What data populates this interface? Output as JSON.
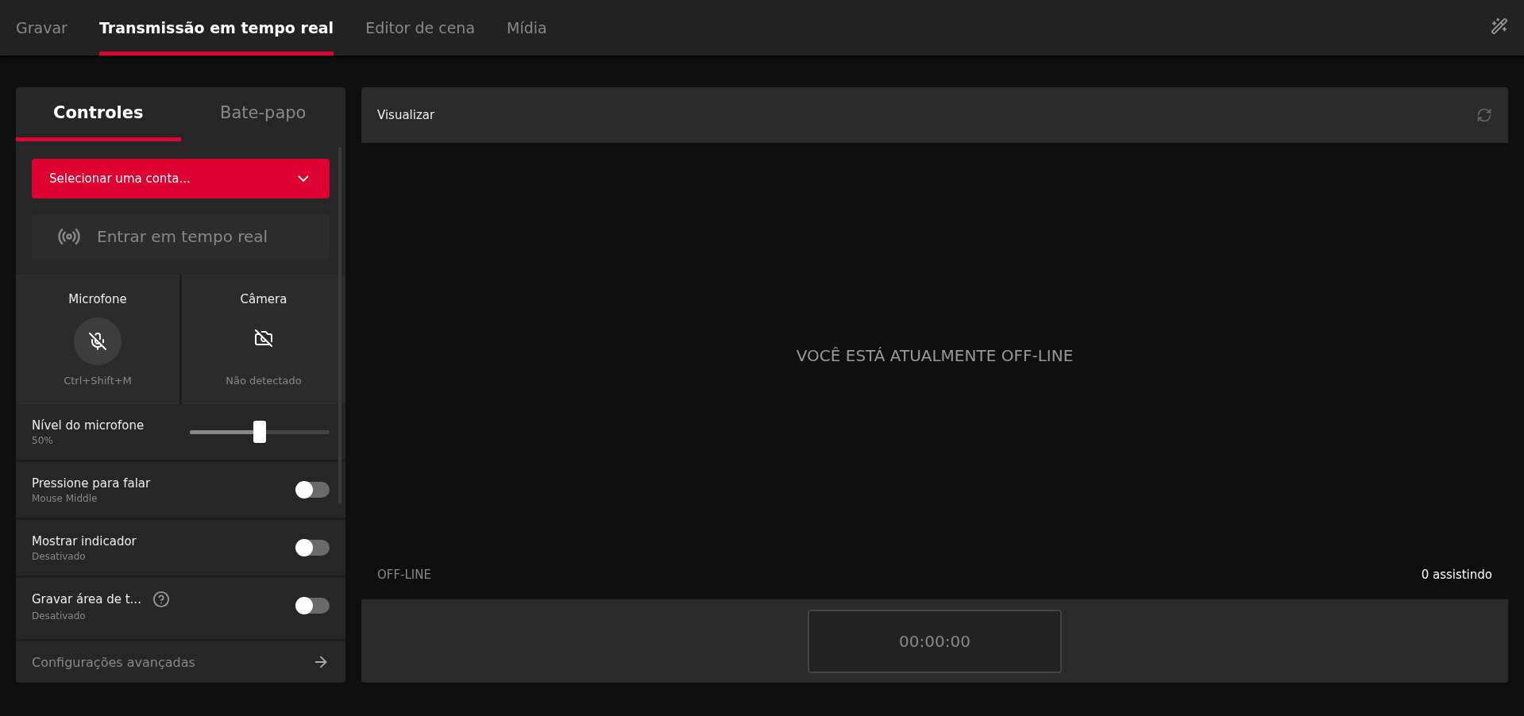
{
  "top_tabs": [
    {
      "label": "Gravar",
      "selected": false
    },
    {
      "label": "Transmissão em tempo real",
      "selected": true
    },
    {
      "label": "Editor de cena",
      "selected": false
    },
    {
      "label": "Mídia",
      "selected": false
    }
  ],
  "left_panel": {
    "tabs": [
      {
        "label": "Controles",
        "selected": true
      },
      {
        "label": "Bate-papo",
        "selected": false
      }
    ],
    "account_select": {
      "value": "Selecionar uma conta..."
    },
    "go_live_button": {
      "label": "Entrar em tempo real",
      "disabled": true
    },
    "devices": [
      {
        "kind": "mic",
        "title": "Microfone",
        "caption": "Ctrl+Shift+M"
      },
      {
        "kind": "camera",
        "title": "Câmera",
        "caption": "Não detectado"
      }
    ],
    "mic_level": {
      "label": "Nível do microfone",
      "reading": "50%",
      "level": 0.5
    },
    "toggles": [
      {
        "label": "Pressione para falar",
        "sub": "Mouse Middle",
        "on": false,
        "help": false
      },
      {
        "label": "Mostrar indicador",
        "sub": "Desativado",
        "on": false,
        "help": false
      },
      {
        "label": "Gravar área de t...",
        "sub": "Desativado",
        "on": false,
        "help": true
      }
    ],
    "advanced_link": "Configurações avançadas"
  },
  "preview": {
    "title": "Visualizar",
    "message": "VOCÊ ESTÁ ATUALMENTE OFF-LINE",
    "status": "OFF-LINE",
    "viewers": "0 assistindo",
    "timer": "00:00:00"
  }
}
